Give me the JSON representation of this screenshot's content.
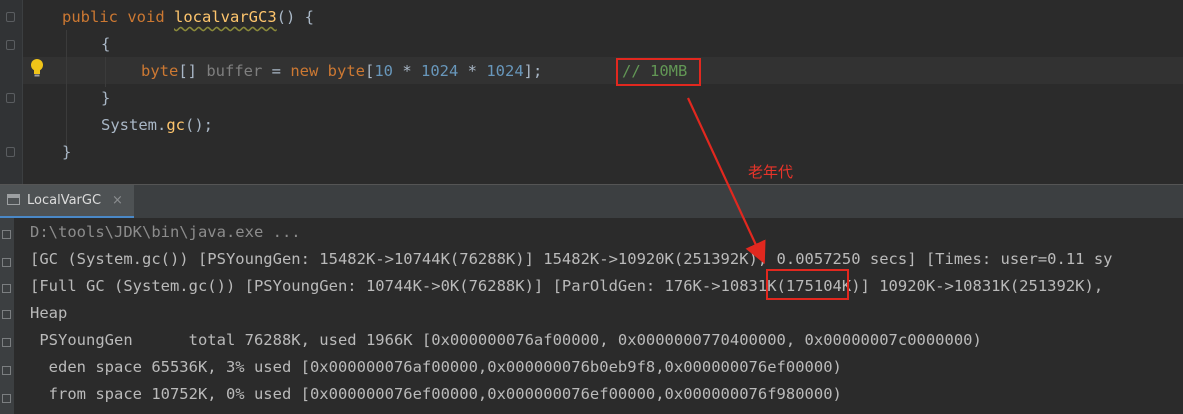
{
  "editor": {
    "lines": {
      "method_kw1": "public",
      "method_kw2": "void",
      "method_name": "localvarGC3",
      "method_tail": "() {",
      "open_brace": "{",
      "type_kw": "byte",
      "decl_mid": "[] ",
      "var_name": "buffer",
      "assign": " = ",
      "new_kw": "new",
      "type_kw2": "byte",
      "arr_open": "[",
      "n1": "10",
      "op1": " * ",
      "n2": "1024",
      "op2": " * ",
      "n3": "1024",
      "arr_close": "];",
      "comment": "// 10MB",
      "close_brace_inner": "}",
      "sys": "System.",
      "gc": "gc",
      "gc_tail": "();",
      "close_brace_method": "}"
    }
  },
  "annotation": {
    "label": "老年代",
    "color": "#e1281f"
  },
  "tool_window": {
    "tab_label": "LocalVarGC",
    "tab_close": "×"
  },
  "console": {
    "lines": [
      "D:\\tools\\JDK\\bin\\java.exe ...",
      "[GC (System.gc()) [PSYoungGen: 15482K->10744K(76288K)] 15482K->10920K(251392K), 0.0057250 secs] [Times: user=0.11 sy",
      "[Full GC (System.gc()) [PSYoungGen: 10744K->0K(76288K)] [ParOldGen: 176K->10831K(175104K)] 10920K->10831K(251392K),",
      "Heap",
      " PSYoungGen      total 76288K, used 1966K [0x000000076af00000, 0x0000000770400000, 0x00000007c0000000)",
      "  eden space 65536K, 3% used [0x000000076af00000,0x000000076b0eb9f8,0x000000076ef00000)",
      "  from space 10752K, 0% used [0x000000076ef00000,0x000000076ef00000,0x000000076f980000)"
    ]
  },
  "colors": {
    "keyword": "#cc7832",
    "method": "#ffc66d",
    "number": "#6897bb",
    "comment": "#629755",
    "highlight_box": "#e1281f",
    "tab_underline": "#4a88c7"
  }
}
